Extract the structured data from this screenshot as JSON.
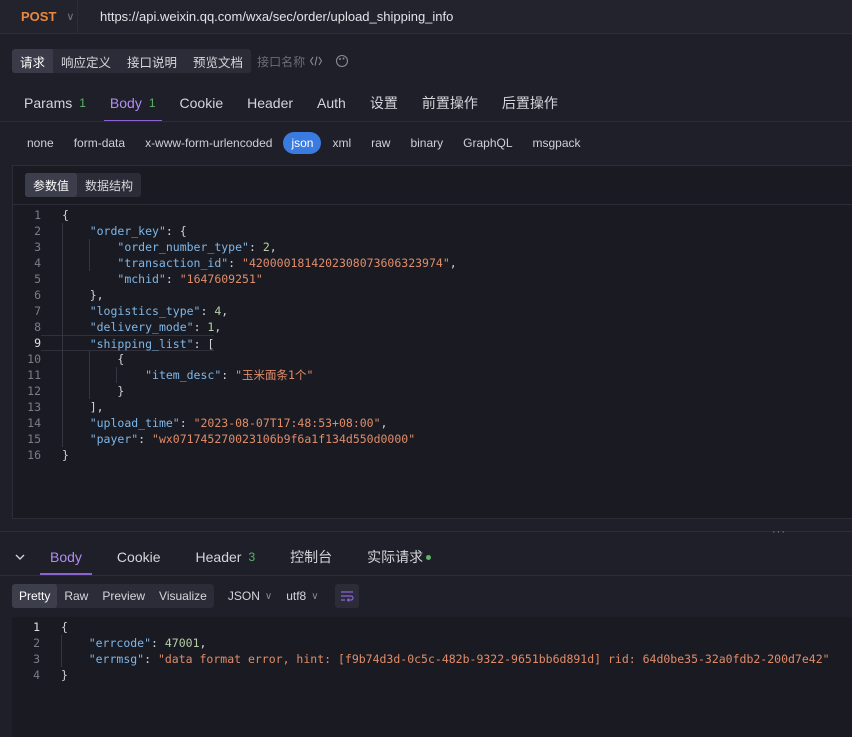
{
  "request": {
    "method": "POST",
    "url": "https://api.weixin.qq.com/wxa/sec/order/upload_shipping_info"
  },
  "doc_tabs": [
    "请求",
    "响应定义",
    "接口说明",
    "预览文档"
  ],
  "api_name_placeholder": "接口名称",
  "main_tabs": [
    {
      "label": "Params",
      "badge": "1"
    },
    {
      "label": "Body",
      "badge": "1"
    },
    {
      "label": "Cookie",
      "badge": ""
    },
    {
      "label": "Header",
      "badge": ""
    },
    {
      "label": "Auth",
      "badge": ""
    },
    {
      "label": "设置",
      "badge": ""
    },
    {
      "label": "前置操作",
      "badge": ""
    },
    {
      "label": "后置操作",
      "badge": ""
    }
  ],
  "body_types": [
    "none",
    "form-data",
    "x-www-form-urlencoded",
    "json",
    "xml",
    "raw",
    "binary",
    "GraphQL",
    "msgpack"
  ],
  "body_subtabs": [
    "参数值",
    "数据结构"
  ],
  "request_body_lines": [
    "{",
    "    \"order_key\": {",
    "        \"order_number_type\": 2,",
    "        \"transaction_id\": \"4200001814202308073606323974\",",
    "        \"mchid\": \"1647609251\"",
    "    },",
    "    \"logistics_type\": 4,",
    "    \"delivery_mode\": 1,",
    "    \"shipping_list\": [",
    "        {",
    "            \"item_desc\": \"玉米面条1个\"",
    "        }",
    "    ],",
    "    \"upload_time\": \"2023-08-07T17:48:53+08:00\",",
    "    \"payer\": \"wx071745270023106b9f6a1f134d550d0000\"",
    "}"
  ],
  "response_tabs": [
    {
      "label": "Body",
      "badge": ""
    },
    {
      "label": "Cookie",
      "badge": ""
    },
    {
      "label": "Header",
      "badge": "3"
    },
    {
      "label": "控制台",
      "badge": ""
    },
    {
      "label": "实际请求",
      "badge": ""
    }
  ],
  "view_modes": [
    "Pretty",
    "Raw",
    "Preview",
    "Visualize"
  ],
  "format_select": "JSON",
  "encoding_select": "utf8",
  "response_body_lines": [
    "{",
    "    \"errcode\": 47001,",
    "    \"errmsg\": \"data format error, hint: [f9b74d3d-0c5c-482b-9322-9651bb6d891d] rid: 64d0be35-32a0fdb2-200d7e42\"",
    "}"
  ],
  "colors": {
    "method": "#e8893f",
    "accent": "#8a63d2",
    "json_active": "#3a7be0",
    "badge": "#5db36a"
  }
}
